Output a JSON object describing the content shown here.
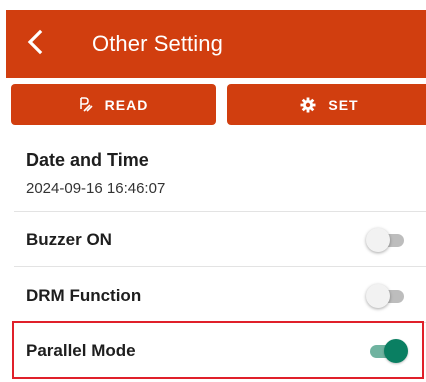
{
  "header": {
    "title": "Other Setting",
    "back_icon": "chevron-left-icon",
    "background": "#d13e0f"
  },
  "actions": {
    "read_label": "READ",
    "read_icon": "read-icon",
    "set_label": "SET",
    "set_icon": "gear-icon"
  },
  "datetime": {
    "title": "Date and Time",
    "value": "2024-09-16 16:46:07"
  },
  "settings": [
    {
      "label": "Buzzer ON",
      "enabled": false
    },
    {
      "label": "DRM Function",
      "enabled": false
    },
    {
      "label": "Parallel Mode",
      "enabled": true
    }
  ],
  "colors": {
    "accent": "#d13e0f",
    "toggle_on": "#0a7f62",
    "highlight": "#e0202a"
  }
}
